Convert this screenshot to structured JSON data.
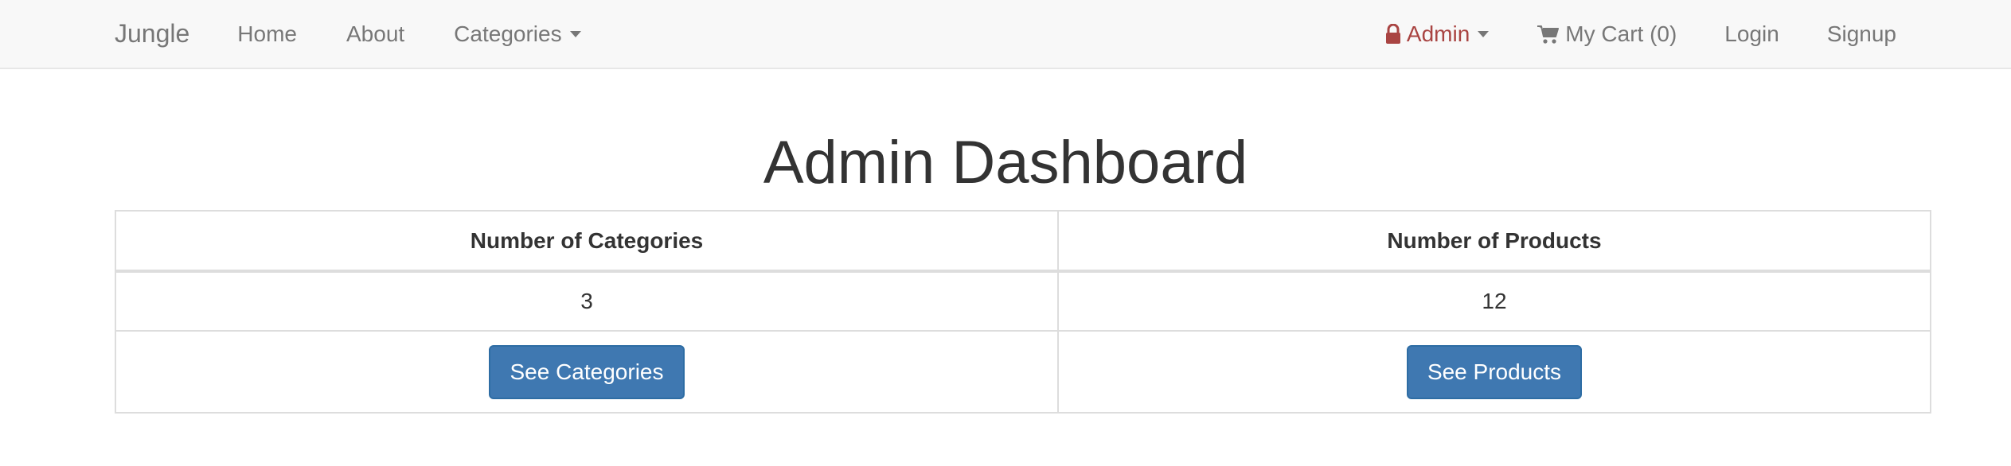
{
  "navbar": {
    "brand": "Jungle",
    "left_links": {
      "home": "Home",
      "about": "About",
      "categories": "Categories"
    },
    "right_links": {
      "admin": "Admin",
      "cart": "My Cart (0)",
      "login": "Login",
      "signup": "Signup"
    },
    "icons": {
      "admin": "lock-icon",
      "cart": "shopping-cart-icon"
    },
    "colors": {
      "background": "#f8f8f8",
      "link": "#777777",
      "admin": "#a94442"
    }
  },
  "main": {
    "title": "Admin Dashboard",
    "table": {
      "headers": [
        "Number of Categories",
        "Number of Products"
      ],
      "values": [
        "3",
        "12"
      ],
      "buttons": [
        "See Categories",
        "See Products"
      ]
    },
    "colors": {
      "button": "#3f78b1",
      "border": "#dddddd"
    }
  }
}
